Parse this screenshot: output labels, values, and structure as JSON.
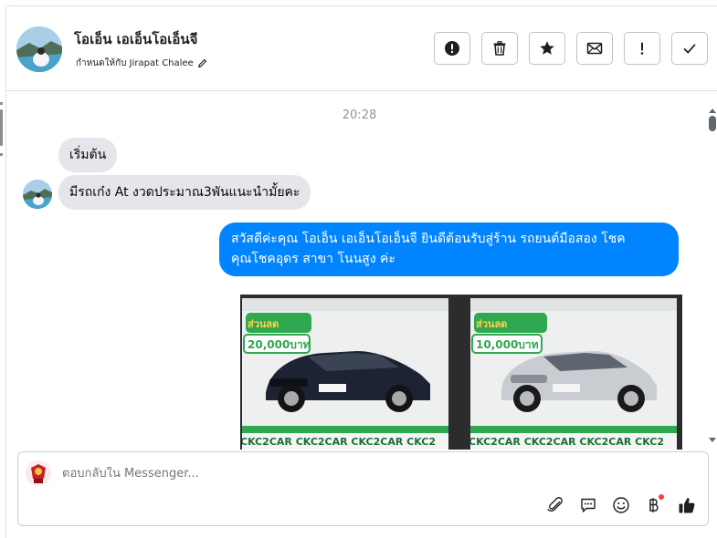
{
  "header": {
    "contact_name": "โอเอ็น เอเอ็นโอเอ็นจี",
    "assigned_label": "กำหนดให้กับ Jirapat Chalee",
    "actions": [
      {
        "name": "spam-button",
        "icon": "exclamation-circle-icon"
      },
      {
        "name": "delete-button",
        "icon": "trash-icon"
      },
      {
        "name": "star-button",
        "icon": "star-icon"
      },
      {
        "name": "mark-unread-button",
        "icon": "envelope-icon"
      },
      {
        "name": "follow-up-button",
        "icon": "exclamation-icon"
      },
      {
        "name": "mark-done-button",
        "icon": "check-icon"
      }
    ]
  },
  "thread": {
    "timestamp": "20:28",
    "messages": [
      {
        "direction": "in",
        "text": "เริ่มต้น"
      },
      {
        "direction": "in",
        "text": "มีรถเก๋ง At  งวดประมาณ3พันแนะนำมั้ยคะ"
      },
      {
        "direction": "out",
        "line1": "สวัสดีค่ะคุณ โอเอ็น เอเอ็นโอเอ็นจี ยินดีต้อนรับสู่ร้าน รถยนต์มือสอง โชค",
        "line2": "คุณโชคอุดร สาขา โนนสูง ค่ะ"
      }
    ],
    "photos": [
      {
        "brand_strip": "CKC2CAR CKC2CAR CKC2CAR CKC2",
        "promo_label": "ส่วนลด",
        "promo_amount": "20,000บาท",
        "car_color": "#1d2333"
      },
      {
        "brand_strip": "CKC2CAR CKC2CAR CKC2CAR CKC2",
        "promo_label": "ส่วนลด",
        "promo_amount": "10,000บาท",
        "car_color": "#c9ccd1"
      }
    ]
  },
  "composer": {
    "placeholder": "ตอบกลับใน Messenger...",
    "tools": [
      "paperclip-icon",
      "speech-bubble-icon",
      "emoji-icon",
      "baht-icon",
      "thumbs-up-icon"
    ]
  },
  "colors": {
    "outgoing_bubble": "#0084ff",
    "incoming_bubble": "#e4e6eb",
    "promo_green": "#2fa84f",
    "notification_dot": "#fa3e3e"
  }
}
